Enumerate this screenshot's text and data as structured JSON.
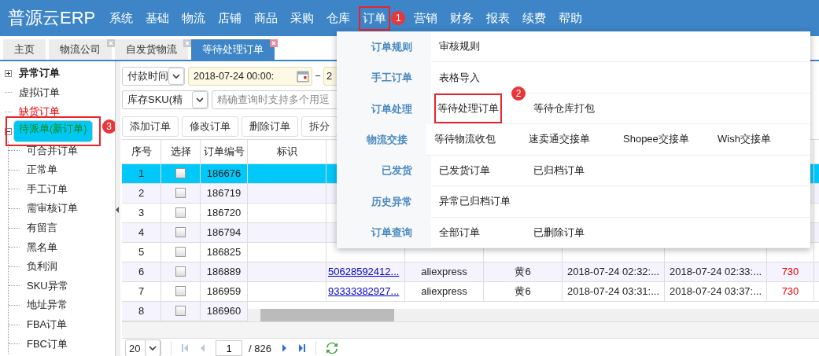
{
  "app": {
    "logo": "普源云ERP"
  },
  "menu": [
    {
      "label": "系统",
      "highlighted": false
    },
    {
      "label": "基础",
      "highlighted": false
    },
    {
      "label": "物流",
      "highlighted": false
    },
    {
      "label": "店铺",
      "highlighted": false
    },
    {
      "label": "商品",
      "highlighted": false
    },
    {
      "label": "采购",
      "highlighted": false
    },
    {
      "label": "仓库",
      "highlighted": false
    },
    {
      "label": "订单",
      "highlighted": true,
      "callout": "1"
    },
    {
      "label": "营销",
      "highlighted": false
    },
    {
      "label": "财务",
      "highlighted": false
    },
    {
      "label": "报表",
      "highlighted": false
    },
    {
      "label": "续费",
      "highlighted": false
    },
    {
      "label": "帮助",
      "highlighted": false
    }
  ],
  "tabs": [
    {
      "label": "主页",
      "selected": false,
      "closable": false
    },
    {
      "label": "物流公司",
      "selected": false,
      "closable": true
    },
    {
      "label": "自发货物流",
      "selected": false,
      "closable": true
    },
    {
      "label": "等待处理订单",
      "selected": true,
      "closable": true
    }
  ],
  "sidebar": {
    "tree": [
      {
        "label": "异常订单",
        "kind": "bold",
        "expanded": false,
        "selected": false,
        "highlighted": false
      },
      {
        "label": "虚拟订单",
        "kind": "normal",
        "selected": false,
        "highlighted": false
      },
      {
        "label": "缺货订单",
        "kind": "alert",
        "selected": false,
        "highlighted": false
      },
      {
        "label": "待派单(新订单)",
        "kind": "normal",
        "expanded": true,
        "selected": true,
        "highlighted": true,
        "callout": "3",
        "children": [
          {
            "label": "可合并订单",
            "selected": false
          },
          {
            "label": "正常单",
            "selected": false
          },
          {
            "label": "手工订单",
            "selected": false
          },
          {
            "label": "需审核订单",
            "selected": false
          },
          {
            "label": "有留言",
            "selected": false
          },
          {
            "label": "黑名单",
            "selected": false
          },
          {
            "label": "负利润",
            "selected": false
          },
          {
            "label": "SKU异常",
            "selected": false
          },
          {
            "label": "地址异常",
            "selected": false
          },
          {
            "label": "FBA订单",
            "selected": false
          },
          {
            "label": "FBC订单",
            "selected": false
          }
        ]
      }
    ]
  },
  "filters": {
    "date_field": "付款时间",
    "date_from": "2018-07-24 00:00:",
    "date_to": "2",
    "search_field": "库存SKU(精",
    "search": {
      "placeholder": "精确查询时支持多个用逗"
    }
  },
  "toolbar": [
    "添加订单",
    "修改订单",
    "删除订单",
    "拆分"
  ],
  "table": {
    "columns": [
      "序号",
      "选择",
      "订单编号",
      "标识"
    ],
    "rows": [
      {
        "seq": "1",
        "checked": false,
        "order_no": "186676",
        "selected": true
      },
      {
        "seq": "2",
        "checked": false,
        "order_no": "186719",
        "selected": false
      },
      {
        "seq": "3",
        "checked": false,
        "order_no": "186720",
        "selected": false
      },
      {
        "seq": "4",
        "checked": false,
        "order_no": "186794",
        "selected": false
      },
      {
        "seq": "5",
        "checked": false,
        "order_no": "186825",
        "selected": false
      },
      {
        "seq": "6",
        "checked": false,
        "order_no": "186889",
        "selected": false,
        "column_5": "50628592412...",
        "column_6": "aliexpress",
        "column_7": "黄6",
        "column_8": "2018-07-24 02:32:...",
        "column_9": "2018-07-24 02:33:...",
        "column_10": "730"
      },
      {
        "seq": "7",
        "checked": false,
        "order_no": "186959",
        "selected": false,
        "column_5": "93333382927...",
        "column_6": "aliexpress",
        "column_7": "黄6",
        "column_8": "2018-07-24 03:31:...",
        "column_9": "2018-07-24 03:37:...",
        "column_10": "730"
      },
      {
        "seq": "8",
        "checked": false,
        "order_no": "186960",
        "selected": false
      }
    ]
  },
  "pager": {
    "page_size": "20",
    "page": "1",
    "total_pages": "/ 826"
  },
  "dropdown": {
    "groups": [
      {
        "label": "订单规则",
        "items": [
          {
            "label": "审核规则",
            "highlighted": false
          }
        ]
      },
      {
        "label": "手工订单",
        "items": [
          {
            "label": "表格导入",
            "highlighted": false
          }
        ]
      },
      {
        "label": "订单处理",
        "items": [
          {
            "label": "等待处理订单",
            "highlighted": true,
            "callout": "2"
          },
          {
            "label": "等待仓库打包",
            "highlighted": false
          }
        ]
      },
      {
        "label": "物流交接",
        "items": [
          {
            "label": "等待物流收包",
            "highlighted": false
          },
          {
            "label": "速卖通交接单",
            "highlighted": false
          },
          {
            "label": "Shopee交接单",
            "highlighted": false
          },
          {
            "label": "Wish交接单",
            "highlighted": false
          }
        ]
      },
      {
        "label": "已发货",
        "items": [
          {
            "label": "已发货订单",
            "highlighted": false
          },
          {
            "label": "已归档订单",
            "highlighted": false
          }
        ]
      },
      {
        "label": "历史异常",
        "items": [
          {
            "label": "异常已归档订单",
            "highlighted": false
          }
        ]
      },
      {
        "label": "订单查询",
        "items": [
          {
            "label": "全部订单",
            "highlighted": false
          },
          {
            "label": "已删除订单",
            "highlighted": false
          }
        ]
      }
    ]
  }
}
